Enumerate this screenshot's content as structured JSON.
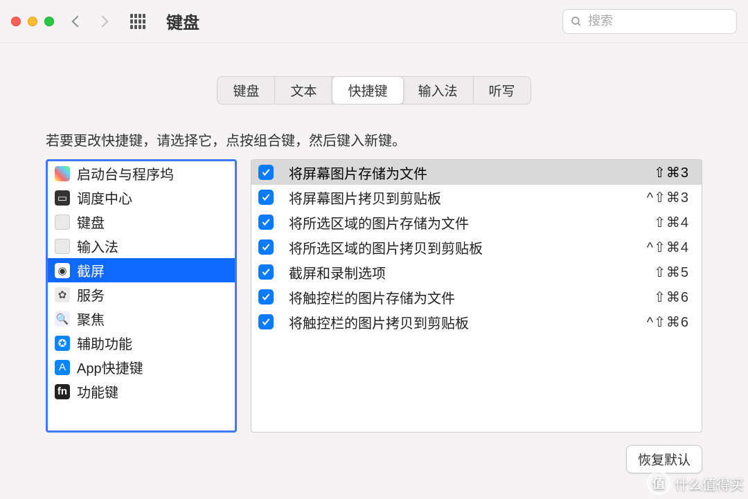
{
  "window": {
    "title": "键盘"
  },
  "search": {
    "placeholder": "搜索"
  },
  "tabs": [
    {
      "label": "键盘",
      "active": false
    },
    {
      "label": "文本",
      "active": false
    },
    {
      "label": "快捷键",
      "active": true
    },
    {
      "label": "输入法",
      "active": false
    },
    {
      "label": "听写",
      "active": false
    }
  ],
  "help_text": "若要更改快捷键，请选择它，点按组合键，然后键入新键。",
  "sidebar": {
    "items": [
      {
        "label": "启动台与程序坞",
        "icon": "launchpad",
        "selected": false
      },
      {
        "label": "调度中心",
        "icon": "mission",
        "selected": false
      },
      {
        "label": "键盘",
        "icon": "keyboard",
        "selected": false
      },
      {
        "label": "输入法",
        "icon": "ime",
        "selected": false
      },
      {
        "label": "截屏",
        "icon": "screenshot",
        "selected": true
      },
      {
        "label": "服务",
        "icon": "services",
        "selected": false
      },
      {
        "label": "聚焦",
        "icon": "spotlight",
        "selected": false
      },
      {
        "label": "辅助功能",
        "icon": "a11y",
        "selected": false
      },
      {
        "label": "App快捷键",
        "icon": "app",
        "selected": false
      },
      {
        "label": "功能键",
        "icon": "fn",
        "selected": false
      }
    ]
  },
  "shortcuts": [
    {
      "checked": true,
      "label": "将屏幕图片存储为文件",
      "keys": "⇧⌘3",
      "selected": true
    },
    {
      "checked": true,
      "label": "将屏幕图片拷贝到剪贴板",
      "keys": "^⇧⌘3",
      "selected": false
    },
    {
      "checked": true,
      "label": "将所选区域的图片存储为文件",
      "keys": "⇧⌘4",
      "selected": false
    },
    {
      "checked": true,
      "label": "将所选区域的图片拷贝到剪贴板",
      "keys": "^⇧⌘4",
      "selected": false
    },
    {
      "checked": true,
      "label": "截屏和录制选项",
      "keys": "⇧⌘5",
      "selected": false
    },
    {
      "checked": true,
      "label": "将触控栏的图片存储为文件",
      "keys": "⇧⌘6",
      "selected": false
    },
    {
      "checked": true,
      "label": "将触控栏的图片拷贝到剪贴板",
      "keys": "^⇧⌘6",
      "selected": false
    }
  ],
  "footer": {
    "restore_defaults": "恢复默认"
  },
  "watermark": {
    "badge": "值",
    "text": "什么值得买"
  }
}
